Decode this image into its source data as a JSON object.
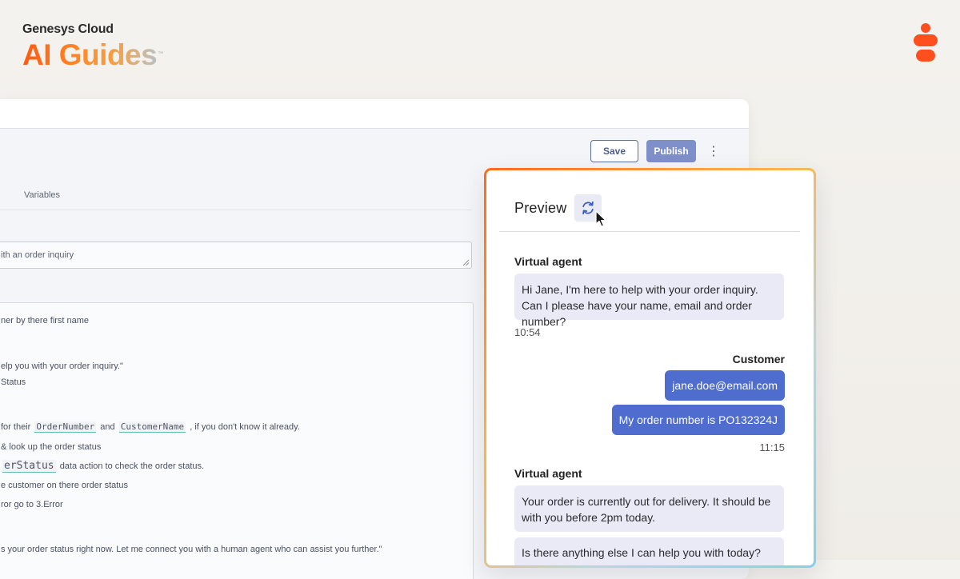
{
  "brand": {
    "company": "Genesys Cloud",
    "product": "AI Guides",
    "trademark": "™",
    "accent_orange": "#ff5a12",
    "logo_icon": "genesys-logo-icon"
  },
  "editor": {
    "toolbar": {
      "save_label": "Save",
      "publish_label": "Publish",
      "more_label": "⋮"
    },
    "tabs": {
      "variables_label": "Variables"
    },
    "description_value": "ith an order inquiry",
    "instructions": {
      "line1": "ner by there first name",
      "line2": "elp you with your order inquiry.\"",
      "line3": "Status",
      "line4_pre": "for their",
      "line4_code1": "OrderNumber",
      "line4_mid": "and",
      "line4_code2": "CustomerName",
      "line4_post": ", if you don't know it already.",
      "line5": "& look up the order status",
      "line6_code": "erStatus",
      "line6_post": "data action to check the order status.",
      "line7": "e customer on there order status",
      "line8": "ror go to 3.Error",
      "line9": "s your order status right now. Let me connect you with a human agent who can assist you further.\""
    },
    "colors": {
      "publish_bg": "#7f8fc9",
      "save_border": "#5b6fa6"
    }
  },
  "preview": {
    "title": "Preview",
    "refresh_icon": "refresh-icon",
    "messages": {
      "agent_label_1": "Virtual agent",
      "agent_msg_1": "Hi Jane, I'm here to help with your order inquiry. Can I please have your name, email and order number?",
      "time_1": "10:54",
      "customer_label": "Customer",
      "customer_msg_1": "jane.doe@email.com",
      "customer_msg_2": "My order number is PO132324J",
      "time_2": "11:15",
      "agent_label_2": "Virtual agent",
      "agent_msg_2": "Your order is currently out for delivery. It should be with you before 2pm today.",
      "agent_msg_3": "Is there anything else I can help you with today?"
    },
    "colors": {
      "agent_bubble": "#e9eaf6",
      "customer_bubble": "#4f6dcf"
    }
  }
}
